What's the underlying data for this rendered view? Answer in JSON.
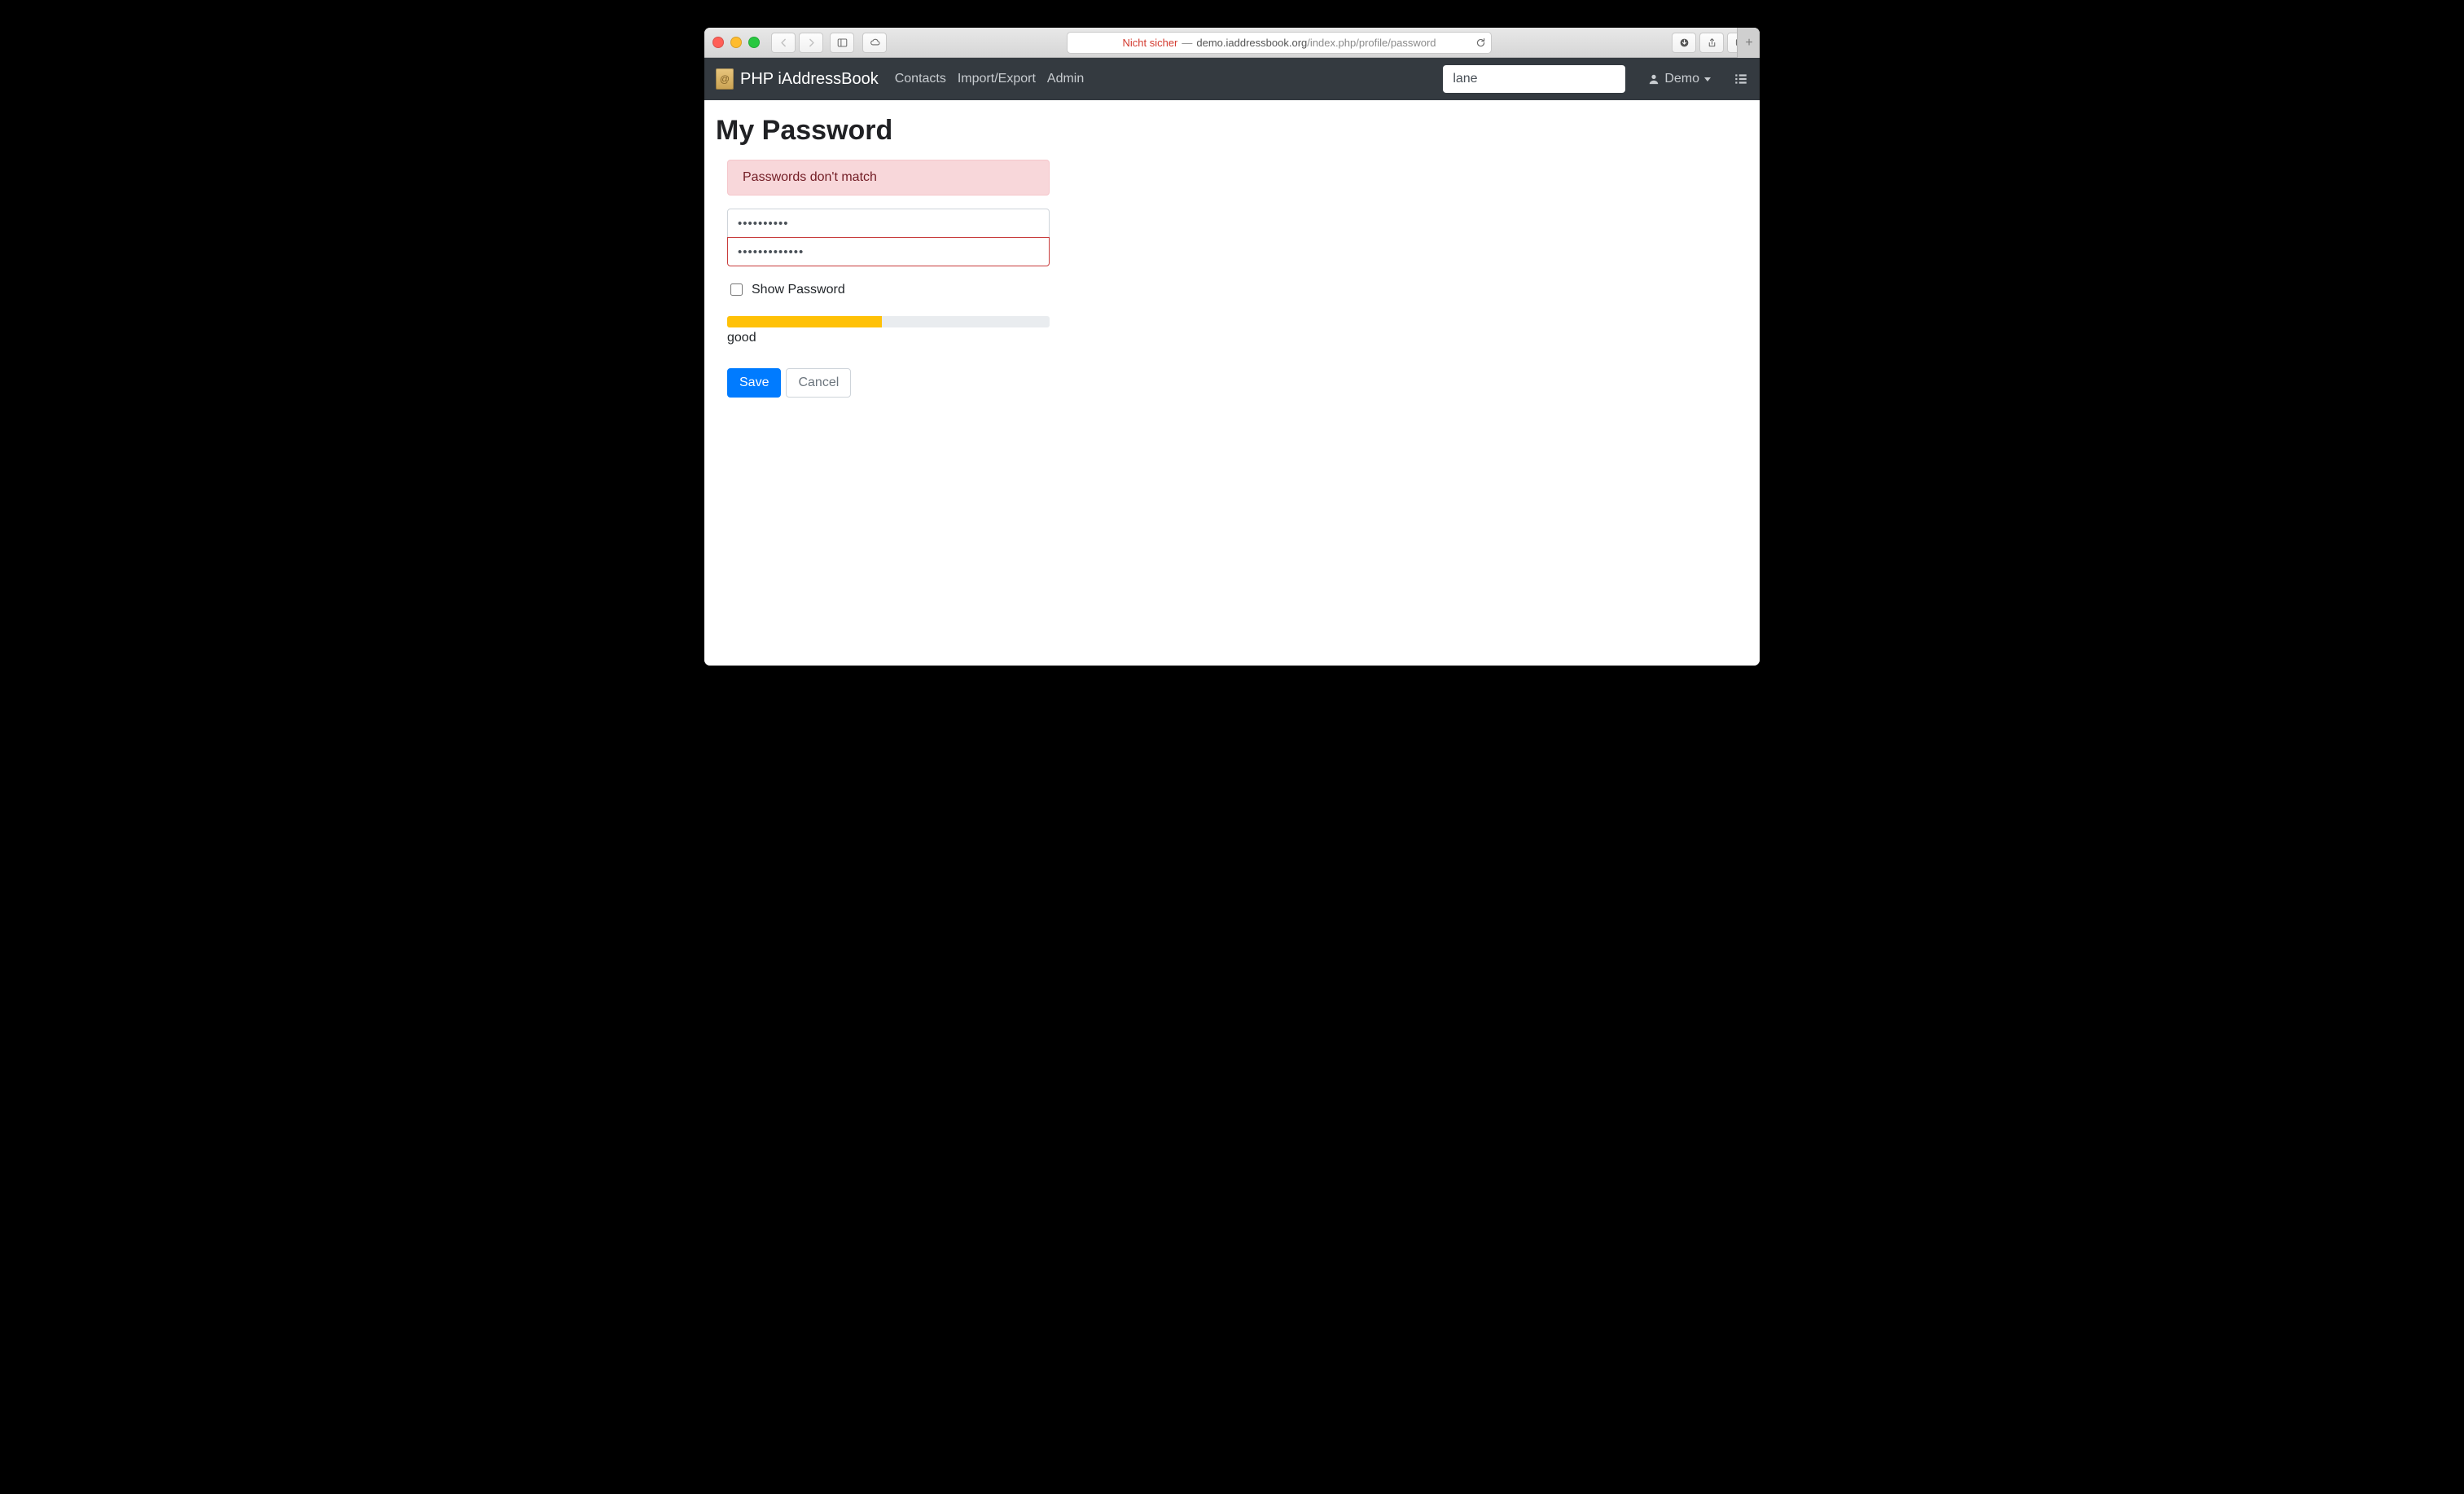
{
  "browser": {
    "insecure_label": "Nicht sicher",
    "url_host": "demo.iaddressbook.org",
    "url_path": "/index.php/profile/password"
  },
  "navbar": {
    "brand": "PHP iAddressBook",
    "links": {
      "contacts": "Contacts",
      "import_export": "Import/Export",
      "admin": "Admin"
    },
    "search_value": "lane",
    "user_label": "Demo"
  },
  "page": {
    "title": "My Password",
    "alert_text": "Passwords don't match",
    "password1_value": "••••••••••",
    "password2_value": "•••••••••••••",
    "show_password_label": "Show Password",
    "strength_percent": 48,
    "strength_color": "#ffc107",
    "strength_label": "good",
    "save_label": "Save",
    "cancel_label": "Cancel"
  }
}
